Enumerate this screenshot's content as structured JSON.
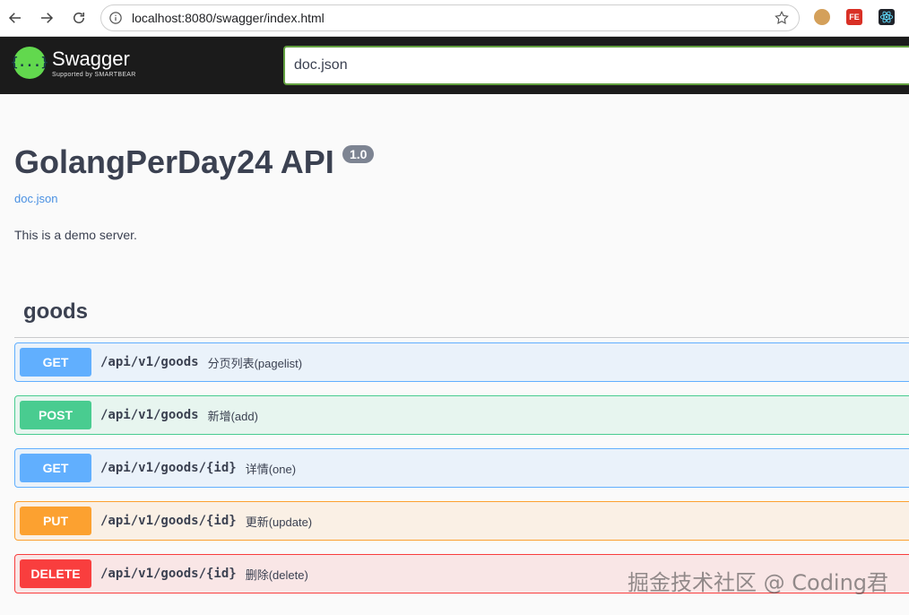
{
  "browser": {
    "url": "localhost:8080/swagger/index.html"
  },
  "topbar": {
    "logo_icon": "{...}",
    "logo_title": "Swagger",
    "logo_sub": "Supported by SMARTBEAR",
    "spec_url": "doc.json"
  },
  "info": {
    "title": "GolangPerDay24 API",
    "version": "1.0",
    "link": "doc.json",
    "description": "This is a demo server."
  },
  "tag": {
    "name": "goods"
  },
  "operations": [
    {
      "method": "GET",
      "path": "/api/v1/goods",
      "summary": "分页列表(pagelist)",
      "color": "#61affe"
    },
    {
      "method": "POST",
      "path": "/api/v1/goods",
      "summary": "新增(add)",
      "color": "#49cc90"
    },
    {
      "method": "GET",
      "path": "/api/v1/goods/{id}",
      "summary": "详情(one)",
      "color": "#61affe"
    },
    {
      "method": "PUT",
      "path": "/api/v1/goods/{id}",
      "summary": "更新(update)",
      "color": "#fca130"
    },
    {
      "method": "DELETE",
      "path": "/api/v1/goods/{id}",
      "summary": "删除(delete)",
      "color": "#f93e3e"
    }
  ],
  "watermark": "掘金技术社区 @ Coding君",
  "icons": [
    "back-icon",
    "forward-icon",
    "reload-icon",
    "info-icon",
    "star-icon",
    "cookie-extension-icon",
    "fe-extension-icon",
    "react-devtools-icon"
  ]
}
